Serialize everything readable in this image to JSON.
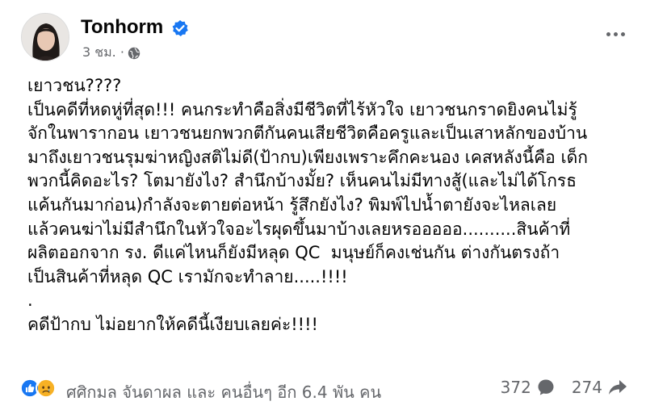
{
  "post": {
    "author": "Tonhorm",
    "time": "3 ชม. ·",
    "body_lines": [
      "เยาวชน????",
      "เป็นคดีที่หดหู่ที่สุด!!! คนกระทำคือสิ่งมีชีวิตที่ไร้หัวใจ เยาวชนกราดยิงคนไม่รู้",
      "จักในพารากอน เยาวชนยกพวกตีกันคนเสียชีวิตคือครูและเป็นเสาหลักของบ้าน",
      "มาถึงเยาวชนรุมฆ่าหญิงสติไม่ดี(ป้ากบ)เพียงเพราะคึกคะนอง เคสหลังนี้คือ เด็ก",
      "พวกนี้คิดอะไร? โตมายังไง? สำนึกบ้างมั้ย? เห็นคนไม่มีทางสู้(และไม่ได้โกรธ",
      "แค้นกันมาก่อน)กำลังจะตายต่อหน้า รู้สึกยังไง? พิมพ์ไปน้ำตายังจะไหลเลย",
      "แล้วคนฆ่าไม่มีสำนึกในหัวใจอะไรผุดขึ้นมาบ้างเลยหรอออออ..........สินค้าที่",
      "ผลิตออกจาก รง. ดีแค่ไหนก็ยังมีหลุด QC  มนุษย์ก็คงเช่นกัน ต่างกันตรงถ้า",
      "เป็นสินค้าที่หลุด QC เรามักจะทำลาย.....!!!!",
      ".",
      "คดีป้ากบ ไม่อยากให้คดีนี้เงียบเลยค่ะ!!!!"
    ]
  },
  "footer": {
    "reaction_text": "ศศิกมล จันดาผล และ คนอื่นๆ อีก 6.4 พัน คน",
    "comment_count": "372",
    "share_count": "274"
  },
  "icons": {
    "verified": "verified-badge-icon",
    "globe": "globe-icon",
    "more": "more-options-icon",
    "like": "like-reaction-icon",
    "sad": "sad-reaction-icon",
    "comment": "comment-icon",
    "share": "share-icon"
  },
  "colors": {
    "verified_blue": "#1877f2",
    "secondary_text": "#65676b",
    "sad_yellow": "#f7b125"
  }
}
